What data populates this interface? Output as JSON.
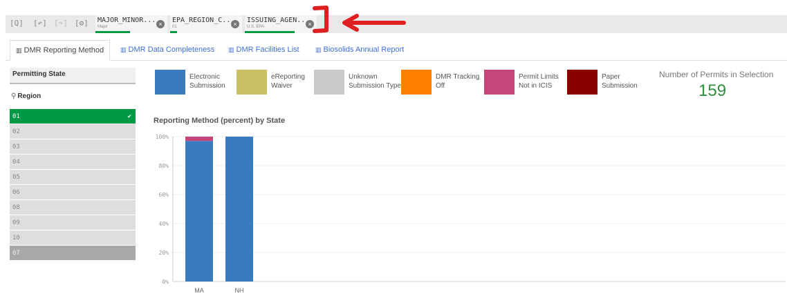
{
  "toolbar": {
    "tools": [
      "[Q]",
      "[↶]",
      "[↷]",
      "[⚙]"
    ]
  },
  "selections": [
    {
      "field": "MAJOR_MINOR...",
      "value": "Major"
    },
    {
      "field": "EPA_REGION_C...",
      "value": "01"
    },
    {
      "field": "ISSUING_AGEN...",
      "value": "U.S. EPA"
    }
  ],
  "tabs": [
    {
      "label": "DMR Reporting Method",
      "active": true
    },
    {
      "label": "DMR Data Completeness",
      "active": false
    },
    {
      "label": "DMR Facilities List",
      "active": false
    },
    {
      "label": "Biosolids Annual Report",
      "active": false
    }
  ],
  "filter": {
    "header": "Permitting State",
    "region_label": "Region",
    "items": [
      "01",
      "02",
      "03",
      "04",
      "05",
      "06",
      "08",
      "09",
      "10",
      "07"
    ]
  },
  "legend": [
    {
      "label": "Electronic Submission",
      "color": "#3a7bbf"
    },
    {
      "label": "eReporting Waiver",
      "color": "#cbbf63"
    },
    {
      "label": "Unknown Submission Type",
      "color": "#c9c9c9"
    },
    {
      "label": "DMR Tracking Off",
      "color": "#ff8000"
    },
    {
      "label": "Permit Limits Not in ICIS",
      "color": "#c4467a"
    },
    {
      "label": "Paper Submission",
      "color": "#8a0000"
    }
  ],
  "kpi": {
    "title": "Number of Permits in Selection",
    "value": "159"
  },
  "chart_title": "Reporting Method (percent) by State",
  "chart_data": {
    "type": "bar",
    "stacked": true,
    "categories": [
      "MA",
      "NH"
    ],
    "series": [
      {
        "name": "Electronic Submission",
        "color": "#3a7bbf",
        "values": [
          97,
          100
        ]
      },
      {
        "name": "Permit Limits Not in ICIS",
        "color": "#c4467a",
        "values": [
          3,
          0
        ]
      }
    ],
    "ylim": [
      0,
      100
    ],
    "yticks": [
      "0%",
      "20%",
      "40%",
      "60%",
      "80%",
      "100%"
    ],
    "grid": true
  }
}
